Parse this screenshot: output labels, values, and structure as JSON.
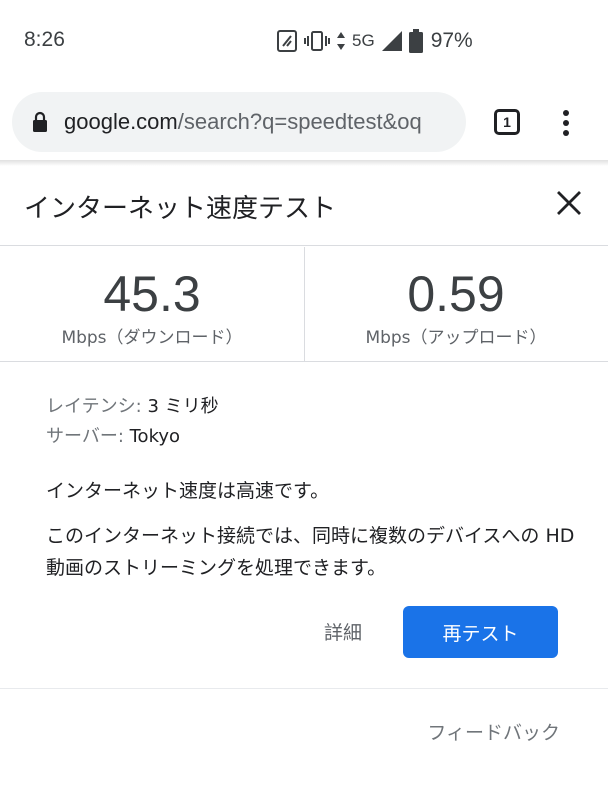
{
  "status_bar": {
    "time": "8:26",
    "network": "5G",
    "battery": "97%",
    "icons": [
      "nfc-icon",
      "vibrate-icon",
      "data-arrows-icon",
      "signal-icon",
      "battery-icon"
    ]
  },
  "browser": {
    "url_host": "google.com",
    "url_path": "/search?q=speedtest&oq",
    "tab_count": "1",
    "icons": [
      "lock-icon",
      "tab-switcher-icon",
      "overflow-menu-icon"
    ]
  },
  "card": {
    "title": "インターネット速度テスト",
    "download": {
      "value": "45.3",
      "unit": "Mbps（ダウンロード）"
    },
    "upload": {
      "value": "0.59",
      "unit": "Mbps（アップロード）"
    },
    "latency_label": "レイテンシ:",
    "latency_value": "3 ミリ秒",
    "server_label": "サーバー:",
    "server_value": "Tokyo",
    "summary": "インターネット速度は高速です。",
    "description": "このインターネット接続では、同時に複数のデバイスへの HD 動画のストリーミングを処理できます。",
    "details_label": "詳細",
    "retest_label": "再テスト",
    "feedback_label": "フィードバック"
  },
  "colors": {
    "accent": "#1a73e8",
    "url_bar_bg": "#f1f3f4",
    "divider": "#dadce0"
  }
}
